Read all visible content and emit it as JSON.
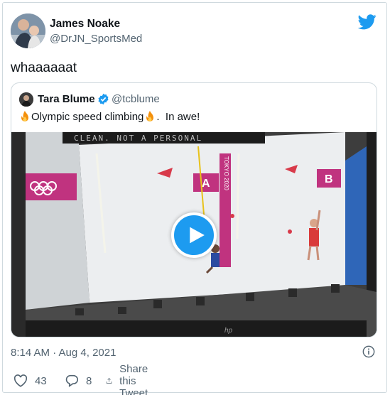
{
  "tweet": {
    "author_name": "James Noake",
    "author_handle": "@DrJN_SportsMed",
    "text": "whaaaaaat",
    "timestamp": "8:14 AM · Aug 4, 2021",
    "likes": "43",
    "replies": "8",
    "share_label": "Share this Tweet"
  },
  "quoted": {
    "author_name": "Tara Blume",
    "author_handle": "@tcblume",
    "text_main": "Olympic speed climbing",
    "text_tail": ".  In awe!",
    "video": {
      "banner_text": "CLEAN.  NOT A PERSONAL",
      "lane_a": "A",
      "lane_b": "B",
      "wall_text": "TOKYO 2020",
      "monitor_brand": "hp"
    }
  },
  "colors": {
    "accent": "#1d9bf0",
    "text": "#0f1419",
    "muted": "#536471",
    "border": "#cfd9de",
    "olympic_magenta": "#c0337f"
  },
  "icons": {
    "brand": "twitter-bird-icon",
    "verified": "verified-badge-icon",
    "emoji": "fire-icon",
    "play": "play-icon",
    "info": "info-icon",
    "like": "heart-icon",
    "reply": "reply-icon",
    "share": "share-icon"
  }
}
